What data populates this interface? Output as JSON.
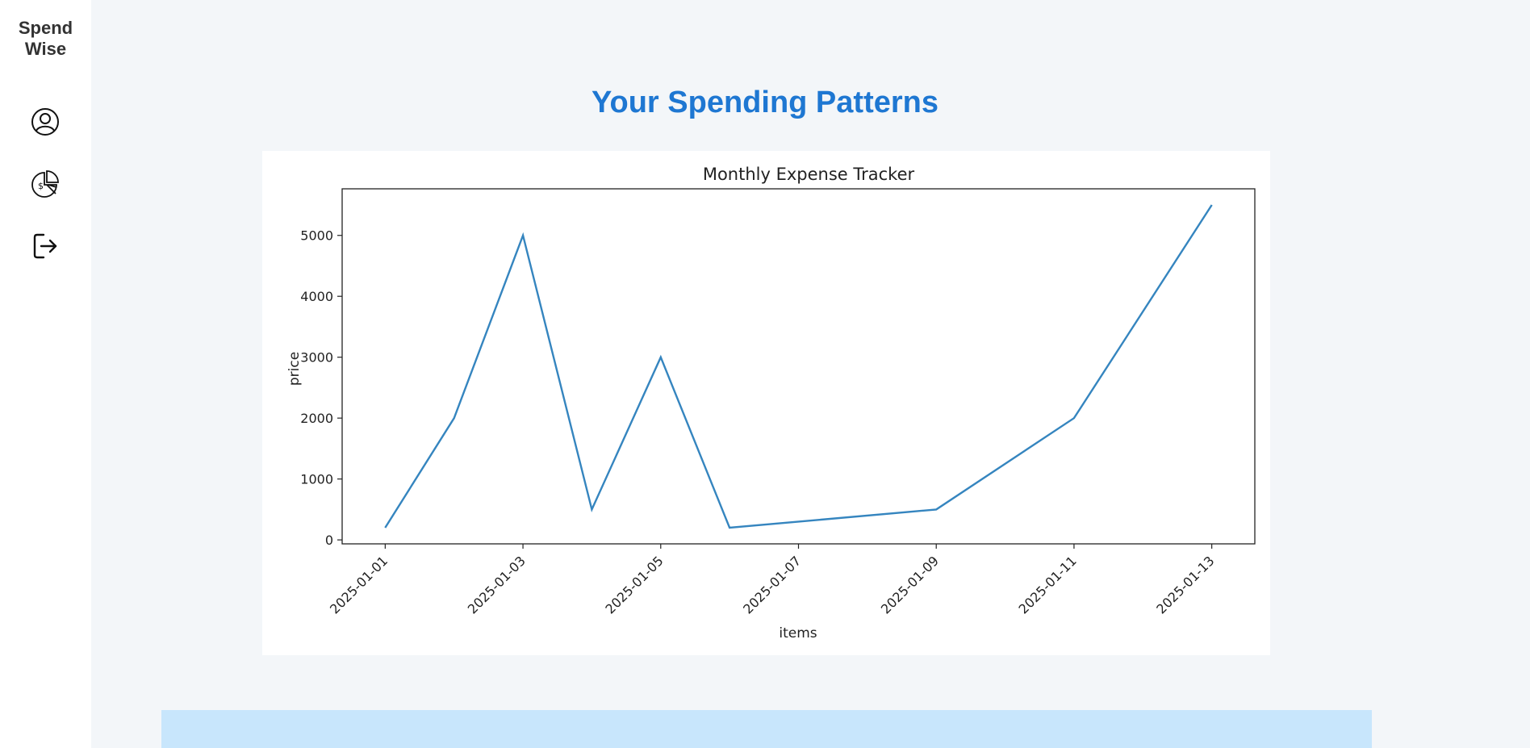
{
  "sidebar": {
    "brand_line1": "Spend",
    "brand_line2": "Wise",
    "items": [
      {
        "icon": "user-circle-icon"
      },
      {
        "icon": "pie-chart-dollar-icon"
      },
      {
        "icon": "logout-icon"
      }
    ]
  },
  "main": {
    "title": "Your Spending Patterns"
  },
  "colors": {
    "title": "#1e77d2",
    "line": "#3585bf",
    "bottom_panel": "#c8e6fc",
    "background": "#f3f6f9"
  },
  "chart_data": {
    "type": "line",
    "title": "Monthly Expense Tracker",
    "xlabel": "items",
    "ylabel": "price",
    "x": [
      "2025-01-01",
      "2025-01-02",
      "2025-01-03",
      "2025-01-04",
      "2025-01-05",
      "2025-01-06",
      "2025-01-09",
      "2025-01-11",
      "2025-01-13"
    ],
    "series": [
      {
        "values": [
          200,
          2000,
          5000,
          500,
          3000,
          200,
          500,
          2000,
          5500
        ]
      }
    ],
    "xticks": [
      "2025-01-01",
      "2025-01-03",
      "2025-01-05",
      "2025-01-07",
      "2025-01-09",
      "2025-01-11",
      "2025-01-13"
    ],
    "yticks": [
      0,
      1000,
      2000,
      3000,
      4000,
      5000
    ],
    "xlim": [
      "2024-12-31T09:00",
      "2025-01-13T15:00"
    ],
    "ylim": [
      -65,
      5765
    ],
    "grid": false,
    "legend": "none"
  }
}
